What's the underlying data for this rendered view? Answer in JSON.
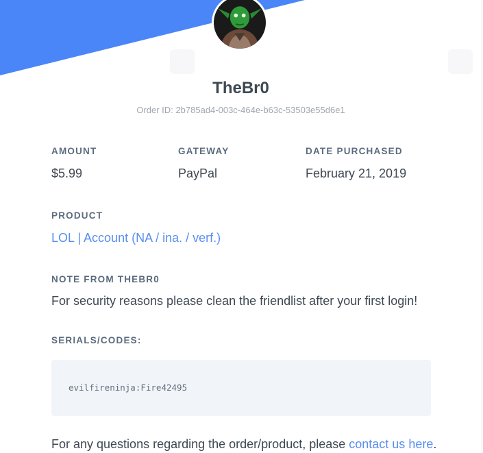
{
  "seller": {
    "name": "TheBr0",
    "order_id_label": "Order ID:",
    "order_id": "2b785ad4-003c-464e-b63c-53503e55d6e1"
  },
  "summary": {
    "amount_label": "AMOUNT",
    "amount": "$5.99",
    "gateway_label": "GATEWAY",
    "gateway": "PayPal",
    "date_label": "DATE PURCHASED",
    "date": "February 21, 2019"
  },
  "product": {
    "label": "PRODUCT",
    "name": "LOL | Account (NA / ina. / verf.)"
  },
  "note": {
    "label": "NOTE FROM THEBR0",
    "text": "For security reasons please clean the friendlist after your first login!"
  },
  "serials": {
    "label": "SERIALS/CODES:",
    "code": "evilfireninja:Fire42495"
  },
  "footer": {
    "text": "For any questions regarding the order/product, please ",
    "link": "contact us here",
    "suffix": "."
  },
  "colors": {
    "accent": "#4a86f7",
    "link": "#5a8ef0",
    "label": "#5b6b7f",
    "code_bg": "#f1f4f8"
  },
  "icons": {
    "avatar": "yoda-avatar"
  }
}
